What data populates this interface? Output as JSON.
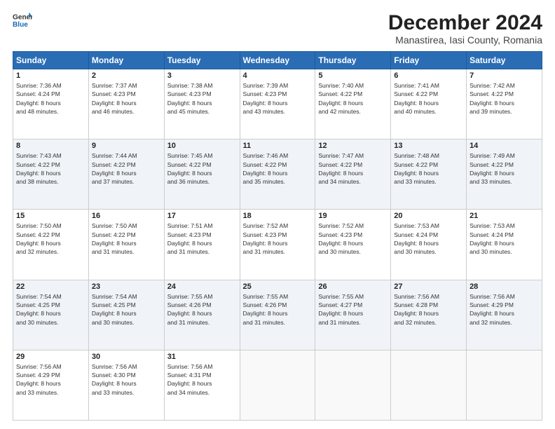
{
  "logo": {
    "line1": "General",
    "line2": "Blue"
  },
  "title": "December 2024",
  "subtitle": "Manastirea, Iasi County, Romania",
  "weekdays": [
    "Sunday",
    "Monday",
    "Tuesday",
    "Wednesday",
    "Thursday",
    "Friday",
    "Saturday"
  ],
  "weeks": [
    [
      {
        "day": "1",
        "info": "Sunrise: 7:36 AM\nSunset: 4:24 PM\nDaylight: 8 hours\nand 48 minutes."
      },
      {
        "day": "2",
        "info": "Sunrise: 7:37 AM\nSunset: 4:23 PM\nDaylight: 8 hours\nand 46 minutes."
      },
      {
        "day": "3",
        "info": "Sunrise: 7:38 AM\nSunset: 4:23 PM\nDaylight: 8 hours\nand 45 minutes."
      },
      {
        "day": "4",
        "info": "Sunrise: 7:39 AM\nSunset: 4:23 PM\nDaylight: 8 hours\nand 43 minutes."
      },
      {
        "day": "5",
        "info": "Sunrise: 7:40 AM\nSunset: 4:22 PM\nDaylight: 8 hours\nand 42 minutes."
      },
      {
        "day": "6",
        "info": "Sunrise: 7:41 AM\nSunset: 4:22 PM\nDaylight: 8 hours\nand 40 minutes."
      },
      {
        "day": "7",
        "info": "Sunrise: 7:42 AM\nSunset: 4:22 PM\nDaylight: 8 hours\nand 39 minutes."
      }
    ],
    [
      {
        "day": "8",
        "info": "Sunrise: 7:43 AM\nSunset: 4:22 PM\nDaylight: 8 hours\nand 38 minutes."
      },
      {
        "day": "9",
        "info": "Sunrise: 7:44 AM\nSunset: 4:22 PM\nDaylight: 8 hours\nand 37 minutes."
      },
      {
        "day": "10",
        "info": "Sunrise: 7:45 AM\nSunset: 4:22 PM\nDaylight: 8 hours\nand 36 minutes."
      },
      {
        "day": "11",
        "info": "Sunrise: 7:46 AM\nSunset: 4:22 PM\nDaylight: 8 hours\nand 35 minutes."
      },
      {
        "day": "12",
        "info": "Sunrise: 7:47 AM\nSunset: 4:22 PM\nDaylight: 8 hours\nand 34 minutes."
      },
      {
        "day": "13",
        "info": "Sunrise: 7:48 AM\nSunset: 4:22 PM\nDaylight: 8 hours\nand 33 minutes."
      },
      {
        "day": "14",
        "info": "Sunrise: 7:49 AM\nSunset: 4:22 PM\nDaylight: 8 hours\nand 33 minutes."
      }
    ],
    [
      {
        "day": "15",
        "info": "Sunrise: 7:50 AM\nSunset: 4:22 PM\nDaylight: 8 hours\nand 32 minutes."
      },
      {
        "day": "16",
        "info": "Sunrise: 7:50 AM\nSunset: 4:22 PM\nDaylight: 8 hours\nand 31 minutes."
      },
      {
        "day": "17",
        "info": "Sunrise: 7:51 AM\nSunset: 4:23 PM\nDaylight: 8 hours\nand 31 minutes."
      },
      {
        "day": "18",
        "info": "Sunrise: 7:52 AM\nSunset: 4:23 PM\nDaylight: 8 hours\nand 31 minutes."
      },
      {
        "day": "19",
        "info": "Sunrise: 7:52 AM\nSunset: 4:23 PM\nDaylight: 8 hours\nand 30 minutes."
      },
      {
        "day": "20",
        "info": "Sunrise: 7:53 AM\nSunset: 4:24 PM\nDaylight: 8 hours\nand 30 minutes."
      },
      {
        "day": "21",
        "info": "Sunrise: 7:53 AM\nSunset: 4:24 PM\nDaylight: 8 hours\nand 30 minutes."
      }
    ],
    [
      {
        "day": "22",
        "info": "Sunrise: 7:54 AM\nSunset: 4:25 PM\nDaylight: 8 hours\nand 30 minutes."
      },
      {
        "day": "23",
        "info": "Sunrise: 7:54 AM\nSunset: 4:25 PM\nDaylight: 8 hours\nand 30 minutes."
      },
      {
        "day": "24",
        "info": "Sunrise: 7:55 AM\nSunset: 4:26 PM\nDaylight: 8 hours\nand 31 minutes."
      },
      {
        "day": "25",
        "info": "Sunrise: 7:55 AM\nSunset: 4:26 PM\nDaylight: 8 hours\nand 31 minutes."
      },
      {
        "day": "26",
        "info": "Sunrise: 7:55 AM\nSunset: 4:27 PM\nDaylight: 8 hours\nand 31 minutes."
      },
      {
        "day": "27",
        "info": "Sunrise: 7:56 AM\nSunset: 4:28 PM\nDaylight: 8 hours\nand 32 minutes."
      },
      {
        "day": "28",
        "info": "Sunrise: 7:56 AM\nSunset: 4:29 PM\nDaylight: 8 hours\nand 32 minutes."
      }
    ],
    [
      {
        "day": "29",
        "info": "Sunrise: 7:56 AM\nSunset: 4:29 PM\nDaylight: 8 hours\nand 33 minutes."
      },
      {
        "day": "30",
        "info": "Sunrise: 7:56 AM\nSunset: 4:30 PM\nDaylight: 8 hours\nand 33 minutes."
      },
      {
        "day": "31",
        "info": "Sunrise: 7:56 AM\nSunset: 4:31 PM\nDaylight: 8 hours\nand 34 minutes."
      },
      null,
      null,
      null,
      null
    ]
  ]
}
